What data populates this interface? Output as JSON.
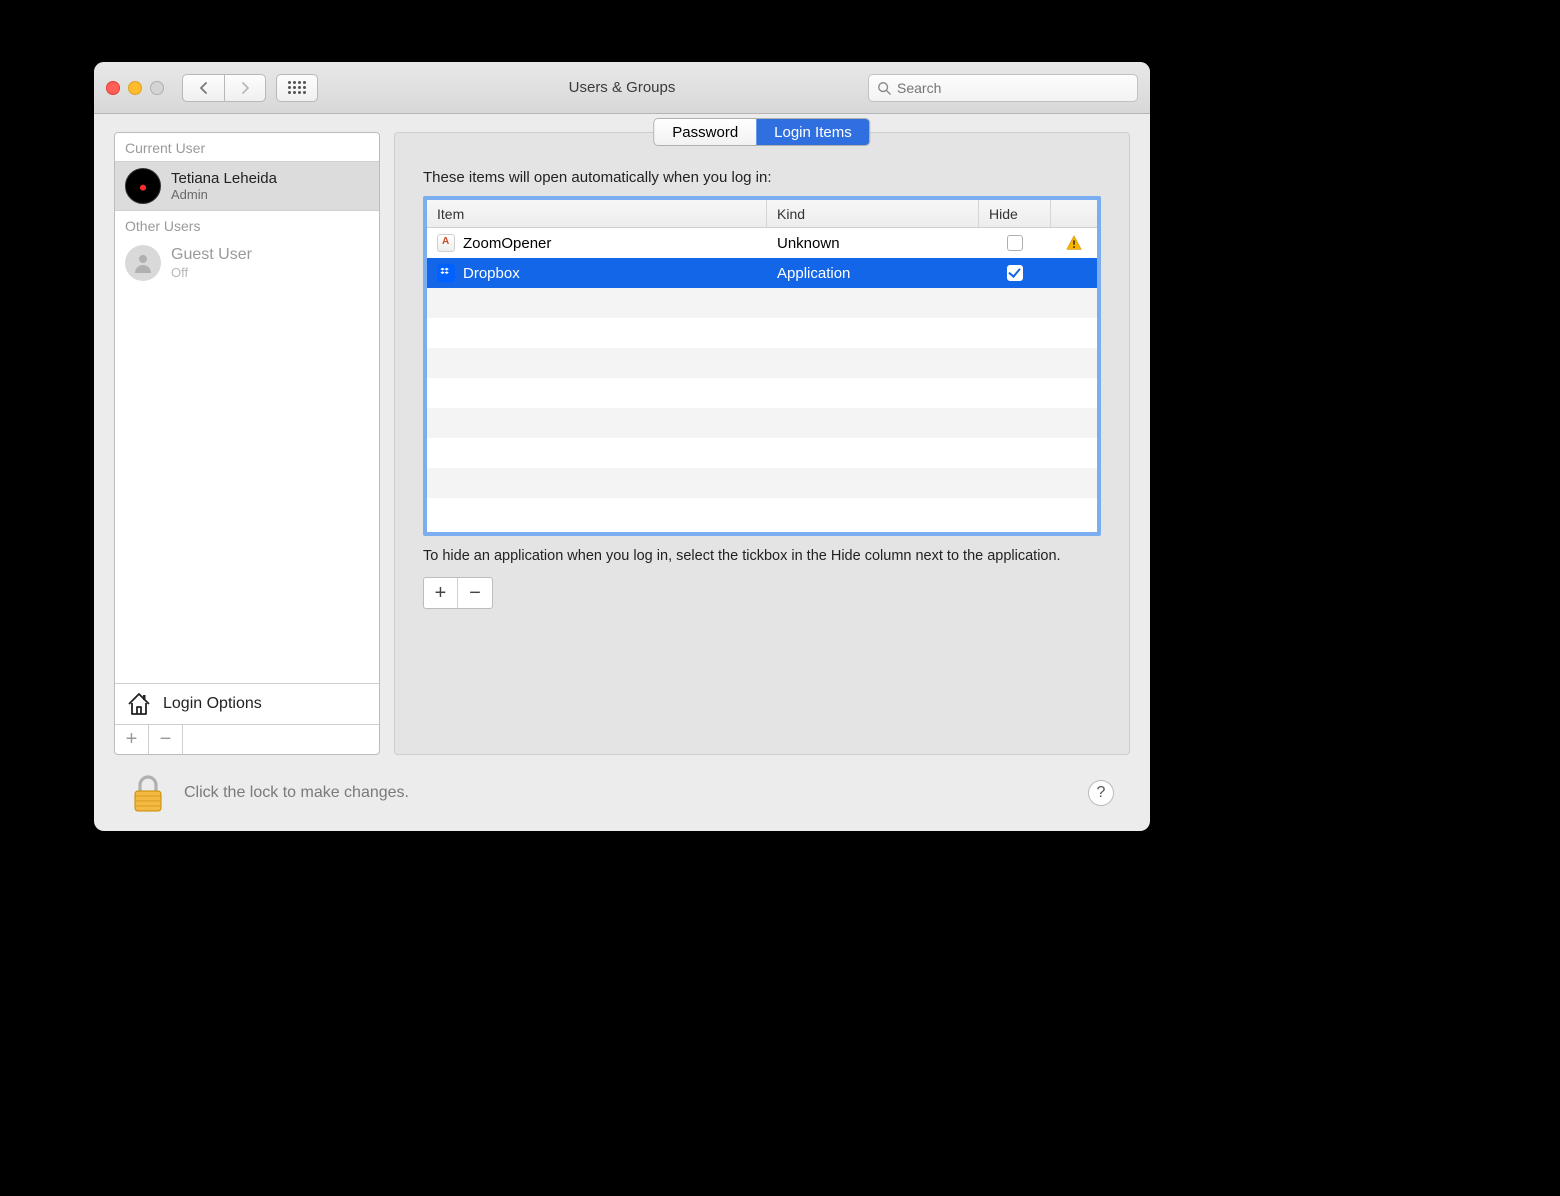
{
  "window": {
    "title": "Users & Groups"
  },
  "toolbar": {
    "search_placeholder": "Search"
  },
  "sidebar": {
    "current_label": "Current User",
    "other_label": "Other Users",
    "current_user": {
      "name": "Tetiana Leheida",
      "role": "Admin"
    },
    "guest_user": {
      "name": "Guest User",
      "status": "Off"
    },
    "login_options_label": "Login Options"
  },
  "tabs": {
    "password": "Password",
    "login_items": "Login Items",
    "active": "login_items"
  },
  "main": {
    "description": "These items will open automatically when you log in:",
    "columns": {
      "item": "Item",
      "kind": "Kind",
      "hide": "Hide"
    },
    "rows": [
      {
        "name": "ZoomOpener",
        "kind": "Unknown",
        "hide": false,
        "warning": true,
        "icon": "zoom",
        "selected": false
      },
      {
        "name": "Dropbox",
        "kind": "Application",
        "hide": true,
        "warning": false,
        "icon": "dropbox",
        "selected": true
      }
    ],
    "hint": "To hide an application when you log in, select the tickbox in the Hide column next to the application."
  },
  "lock": {
    "text": "Click the lock to make changes."
  }
}
